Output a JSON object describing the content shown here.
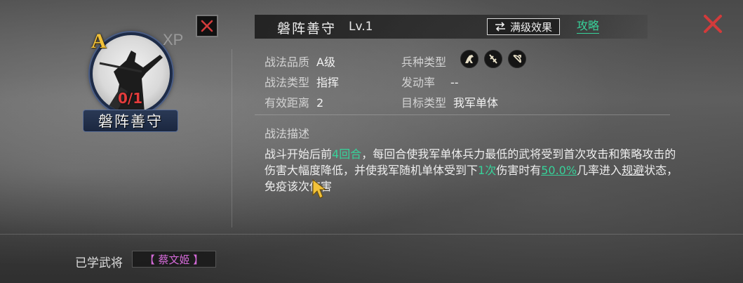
{
  "card": {
    "grade": "A",
    "xp_label": "XP",
    "count": "0/1",
    "banner_name": "磐阵善守"
  },
  "header": {
    "name": "磐阵善守",
    "level": "Lv.1",
    "max_effect_label": "满级效果",
    "guide_label": "攻略"
  },
  "attrs": {
    "quality_label": "战法品质",
    "quality_value": "A级",
    "type_label": "战法类型",
    "type_value": "指挥",
    "range_label": "有效距离",
    "range_value": "2",
    "troop_label": "兵种类型",
    "rate_label": "发动率",
    "rate_value": "--",
    "target_label": "目标类型",
    "target_value": "我军单体"
  },
  "description": {
    "title": "战法描述",
    "p1": "战斗开始后前",
    "p2": "4回合",
    "p3": "，每回合使我军单体兵力最低的武将受到首次攻击和策略攻击的伤害大幅度降低，并使我军随机单体受到下",
    "p4": "1次",
    "p5": "伤害时有",
    "p6": "50.0%",
    "p7": "几率进入",
    "p8": "规避",
    "p9": "状态，免疫该次伤害"
  },
  "footer": {
    "learned_label": "已学武将",
    "learned_general": "【 蔡文姬 】"
  },
  "colors": {
    "accent_green": "#37d29a",
    "grade_gold": "#f2c23a",
    "close_red": "#d23b3b",
    "general_purple": "#d46ad8"
  },
  "icons": [
    "close-icon",
    "swap-arrows-icon",
    "cavalry-icon",
    "infantry-icon",
    "archer-icon"
  ]
}
